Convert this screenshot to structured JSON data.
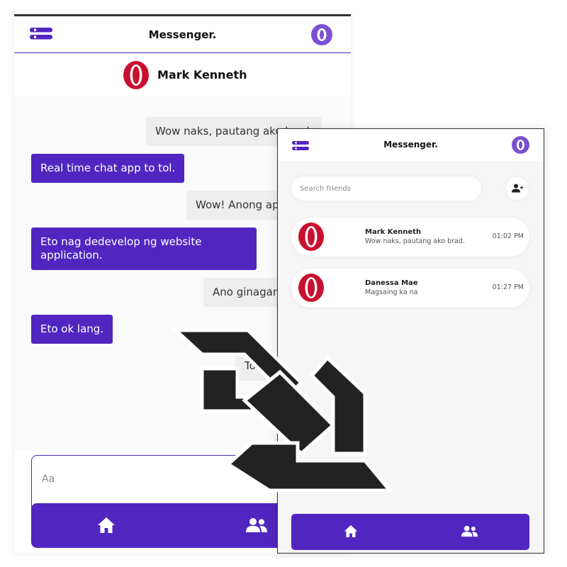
{
  "chat_screen": {
    "app_title": "Messenger.",
    "contact_name": "Mark Kenneth",
    "messages": [
      {
        "direction": "outgoing",
        "text": "Wow naks, pautang ako brad."
      },
      {
        "direction": "incoming",
        "text": "Real time chat app to tol."
      },
      {
        "direction": "outgoing",
        "text": "Wow! Anong app yan?"
      },
      {
        "direction": "incoming",
        "text": "Eto nag dedevelop ng website",
        "text_line2": "application."
      },
      {
        "direction": "outgoing",
        "text": "Ano ginagamit mo?"
      },
      {
        "direction": "incoming",
        "text": "Eto ok lang."
      },
      {
        "direction": "outgoing",
        "text": "Tol?"
      }
    ],
    "composer_placeholder": "Aa",
    "nav_icons": [
      "home-icon",
      "friends-icon"
    ]
  },
  "list_screen": {
    "app_title": "Messenger.",
    "search_placeholder": "Search friends",
    "conversations": [
      {
        "name": "Mark Kenneth",
        "preview": "Wow naks, pautang ako brad.",
        "time": "01:02 PM"
      },
      {
        "name": "Danessa Mae",
        "preview": "Magsaing ka na",
        "time": "01:27 PM"
      }
    ],
    "nav_icons": [
      "home-icon",
      "friends-icon"
    ]
  },
  "colors": {
    "accent": "#5126c0",
    "avatar_red": "#c8102e",
    "profile_purple": "#7b4fd1",
    "outgoing_bubble": "#eeeeee"
  }
}
